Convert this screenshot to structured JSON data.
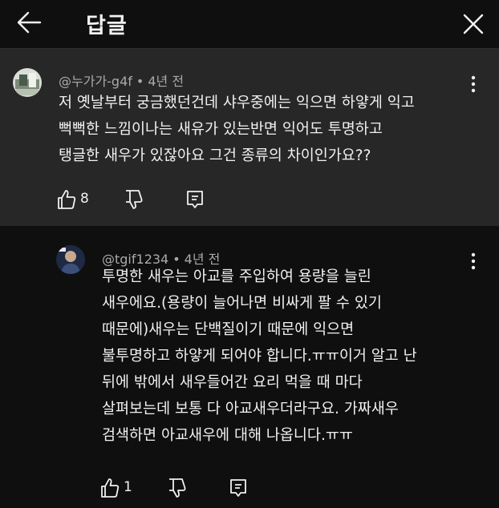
{
  "header": {
    "title": "답글"
  },
  "parent_comment": {
    "author": "@누가가-g4f",
    "age": "4년 전",
    "lines": [
      "저 옛날부터 궁금했던건데 샤우중에는 익으면 하얗게 익고",
      "뻑뻑한 느낌이나는 새유가 있는반면 익어도 투명하고",
      "탱글한 새우가 있잖아요 그건 종류의 차이인가요??"
    ],
    "likes": "8"
  },
  "reply_comment": {
    "author": "@tgif1234",
    "age": "4년 전",
    "lines": [
      "투명한 새우는 아교를 주입하여 용량을 늘린",
      "새우에요.(용량이 늘어나면 비싸게 팔 수 있기",
      "때문에)새우는 단백질이기 때문에 익으면",
      "불투명하고 하얗게 되어야 합니다.ㅠㅠ이거 알고 난",
      "뒤에 밖에서 새우들어간 요리 먹을 때 마다",
      "살펴보는데 보통 다 아교새우더라구요. 가짜새우",
      "검색하면 아교새우에 대해 나옵니다.ㅠㅠ"
    ],
    "likes": "1"
  },
  "meta_separator": "•",
  "icons": {
    "back": "arrow-left-icon",
    "close": "close-icon",
    "more": "more-vert-icon",
    "like": "thumb-up-icon",
    "dislike": "thumb-down-icon",
    "reply": "comment-reply-icon"
  },
  "colors": {
    "background": "#0f0f0f",
    "highlighted_comment_bg": "#272727",
    "primary_text": "#f1f1f1",
    "secondary_text": "#aaaaaa"
  }
}
